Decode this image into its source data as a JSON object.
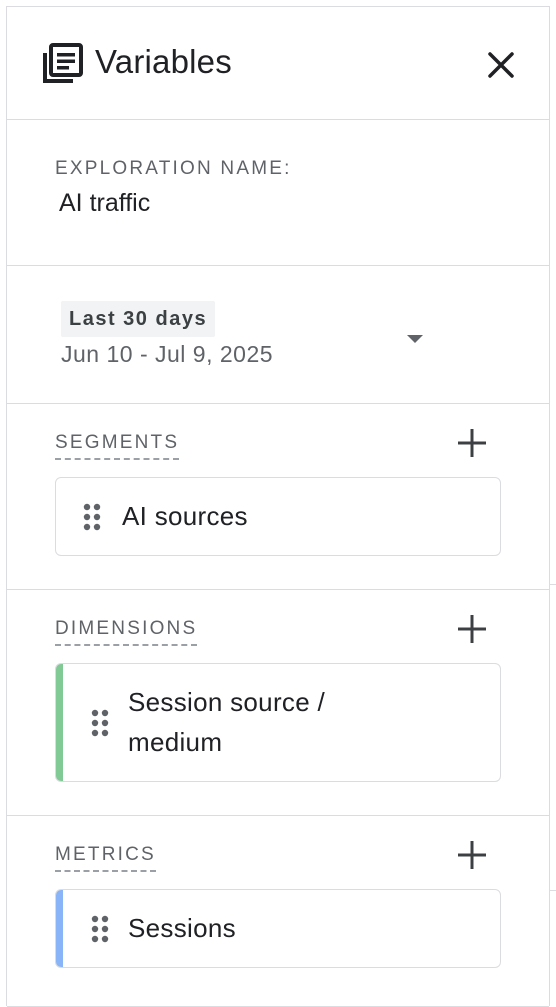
{
  "panel": {
    "title": "Variables",
    "title_icon": "document-list-icon",
    "close_icon": "close-icon"
  },
  "exploration": {
    "label": "EXPLORATION NAME:",
    "value": "AI traffic"
  },
  "date": {
    "preset": "Last 30 days",
    "range": "Jun 10 - Jul 9, 2025"
  },
  "segments": {
    "label": "SEGMENTS",
    "items": [
      {
        "label": "AI sources"
      }
    ]
  },
  "dimensions": {
    "label": "DIMENSIONS",
    "items": [
      {
        "label": "Session source / medium",
        "accent": "#81c995"
      }
    ]
  },
  "metrics": {
    "label": "METRICS",
    "items": [
      {
        "label": "Sessions",
        "accent": "#8ab4f8"
      }
    ]
  },
  "colors": {
    "text": "#202124",
    "muted": "#5f6368",
    "border": "#dadce0",
    "dimension_accent": "#81c995",
    "metric_accent": "#8ab4f8"
  }
}
